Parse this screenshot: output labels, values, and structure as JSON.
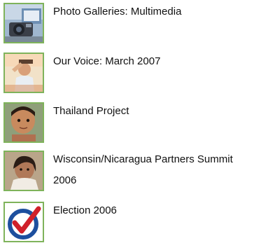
{
  "links": [
    {
      "label": "Photo Galleries:  Multimedia",
      "icon": "camera-photo-thumbnail"
    },
    {
      "label": "Our Voice: March 2007",
      "icon": "man-saluting-photo-thumbnail"
    },
    {
      "label": "Thailand Project",
      "icon": "child-portrait-thumbnail"
    },
    {
      "label_line1": "Wisconsin/Nicaragua Partners Summit",
      "label_line2": "2006",
      "icon": "girl-portrait-thumbnail"
    },
    {
      "label": "Election 2006",
      "icon": "ballot-checkmark-thumbnail"
    }
  ],
  "colors": {
    "thumbnail_border": "#7fb35b",
    "text": "#111111",
    "checkmark_red": "#d0202a",
    "checkmark_blue": "#1d4f9e"
  }
}
